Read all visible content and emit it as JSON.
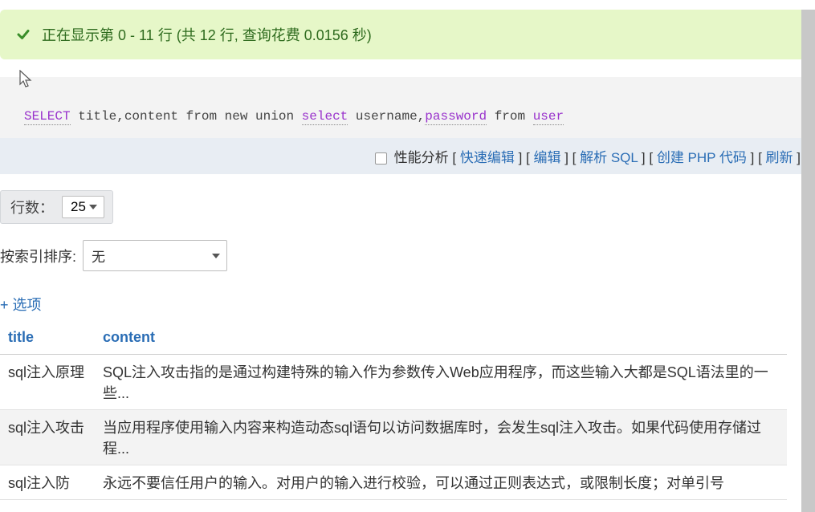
{
  "success": {
    "message": "正在显示第 0 - 11 行 (共 12 行, 查询花费 0.0156 秒)"
  },
  "sql": {
    "tokens": [
      {
        "text": "SELECT",
        "kw": true
      },
      {
        "text": " title,content from new union ",
        "kw": false
      },
      {
        "text": "select",
        "kw": true
      },
      {
        "text": " username,",
        "kw": false
      },
      {
        "text": "password",
        "kw": true
      },
      {
        "text": " from ",
        "kw": false
      },
      {
        "text": "user",
        "kw": true
      }
    ]
  },
  "linkbar": {
    "profiling_label": "性能分析",
    "links": [
      "快速编辑",
      "编辑",
      "解析 SQL",
      "创建 PHP 代码",
      "刷新"
    ]
  },
  "rows_control": {
    "label": "行数：",
    "value": "25"
  },
  "sort_control": {
    "label": "按索引排序:",
    "value": "无"
  },
  "options_link": "+ 选项",
  "table": {
    "columns": [
      "title",
      "content"
    ],
    "rows": [
      {
        "title": "sql注入原理",
        "content": "SQL注入攻击指的是通过构建特殊的输入作为参数传入Web应用程序，而这些输入大都是SQL语法里的一些..."
      },
      {
        "title": "sql注入攻击",
        "content": "当应用程序使用输入内容来构造动态sql语句以访问数据库时，会发生sql注入攻击。如果代码使用存储过程..."
      },
      {
        "title": "sql注入防",
        "content": "永远不要信任用户的输入。对用户的输入进行校验，可以通过正则表达式，或限制长度；对单引号"
      }
    ]
  }
}
